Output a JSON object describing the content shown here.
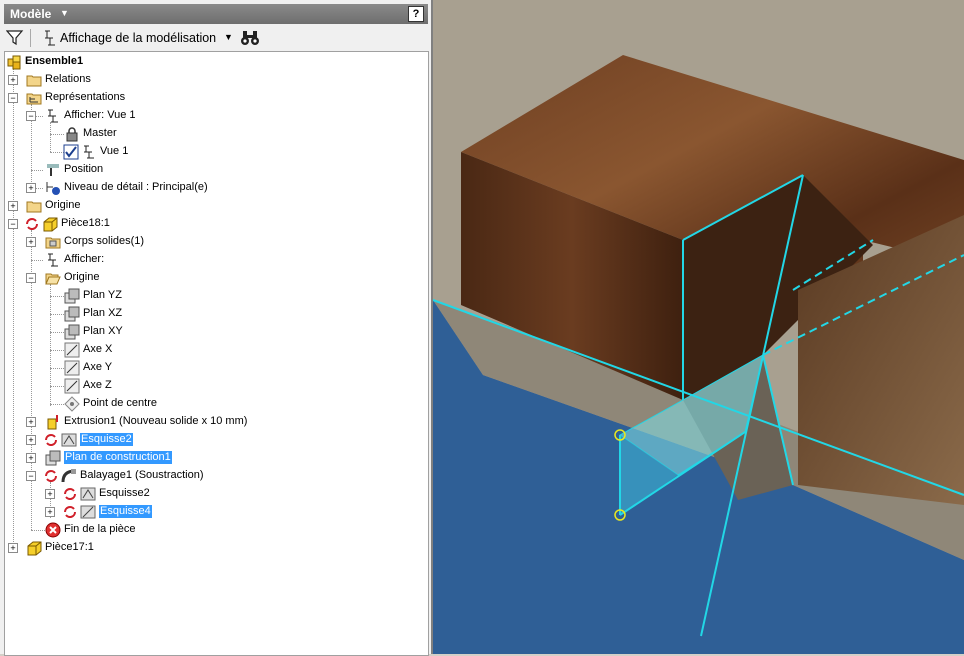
{
  "panel": {
    "title": "Modèle",
    "help_label": "?",
    "view_label": "Affichage de la modélisation"
  },
  "tree": [
    {
      "label": "Ensemble1",
      "icon": "assembly-icon",
      "bold": true
    },
    {
      "label": "Relations",
      "icon": "folder-icon"
    },
    {
      "label": "Représentations",
      "icon": "representations-icon"
    },
    {
      "label": "Afficher: Vue 1",
      "icon": "view-rep-icon"
    },
    {
      "label": "Master",
      "icon": "lock-icon"
    },
    {
      "label": "Vue 1",
      "icon": "view-rep-icon",
      "checked": true
    },
    {
      "label": "Position",
      "icon": "position-icon"
    },
    {
      "label": "Niveau de détail : Principal(e)",
      "icon": "level-of-detail-icon"
    },
    {
      "label": "Origine",
      "icon": "folder-icon"
    },
    {
      "label": "Pièce18:1",
      "icon": "part-icon"
    },
    {
      "label": "Corps solides(1)",
      "icon": "solid-bodies-icon"
    },
    {
      "label": "Afficher:",
      "icon": "view-rep-icon"
    },
    {
      "label": "Origine",
      "icon": "open-folder-icon"
    },
    {
      "label": "Plan YZ",
      "icon": "plane-icon"
    },
    {
      "label": "Plan XZ",
      "icon": "plane-icon"
    },
    {
      "label": "Plan XY",
      "icon": "plane-icon"
    },
    {
      "label": "Axe X",
      "icon": "axis-icon"
    },
    {
      "label": "Axe Y",
      "icon": "axis-icon"
    },
    {
      "label": "Axe Z",
      "icon": "axis-icon"
    },
    {
      "label": "Point de centre",
      "icon": "center-point-icon"
    },
    {
      "label": "Extrusion1 (Nouveau solide x 10 mm)",
      "icon": "extrusion-icon"
    },
    {
      "label": "Esquisse2",
      "icon": "sketch-icon",
      "selected": true
    },
    {
      "label": "Plan de construction1",
      "icon": "work-plane-icon",
      "selected": true
    },
    {
      "label": "Balayage1 (Soustraction)",
      "icon": "sweep-icon"
    },
    {
      "label": "Esquisse2",
      "icon": "sketch-icon"
    },
    {
      "label": "Esquisse4",
      "icon": "sketch-icon",
      "selected": true
    },
    {
      "label": "Fin de la pièce",
      "icon": "end-of-part-icon"
    },
    {
      "label": "Pièce17:1",
      "icon": "part-icon"
    }
  ]
}
